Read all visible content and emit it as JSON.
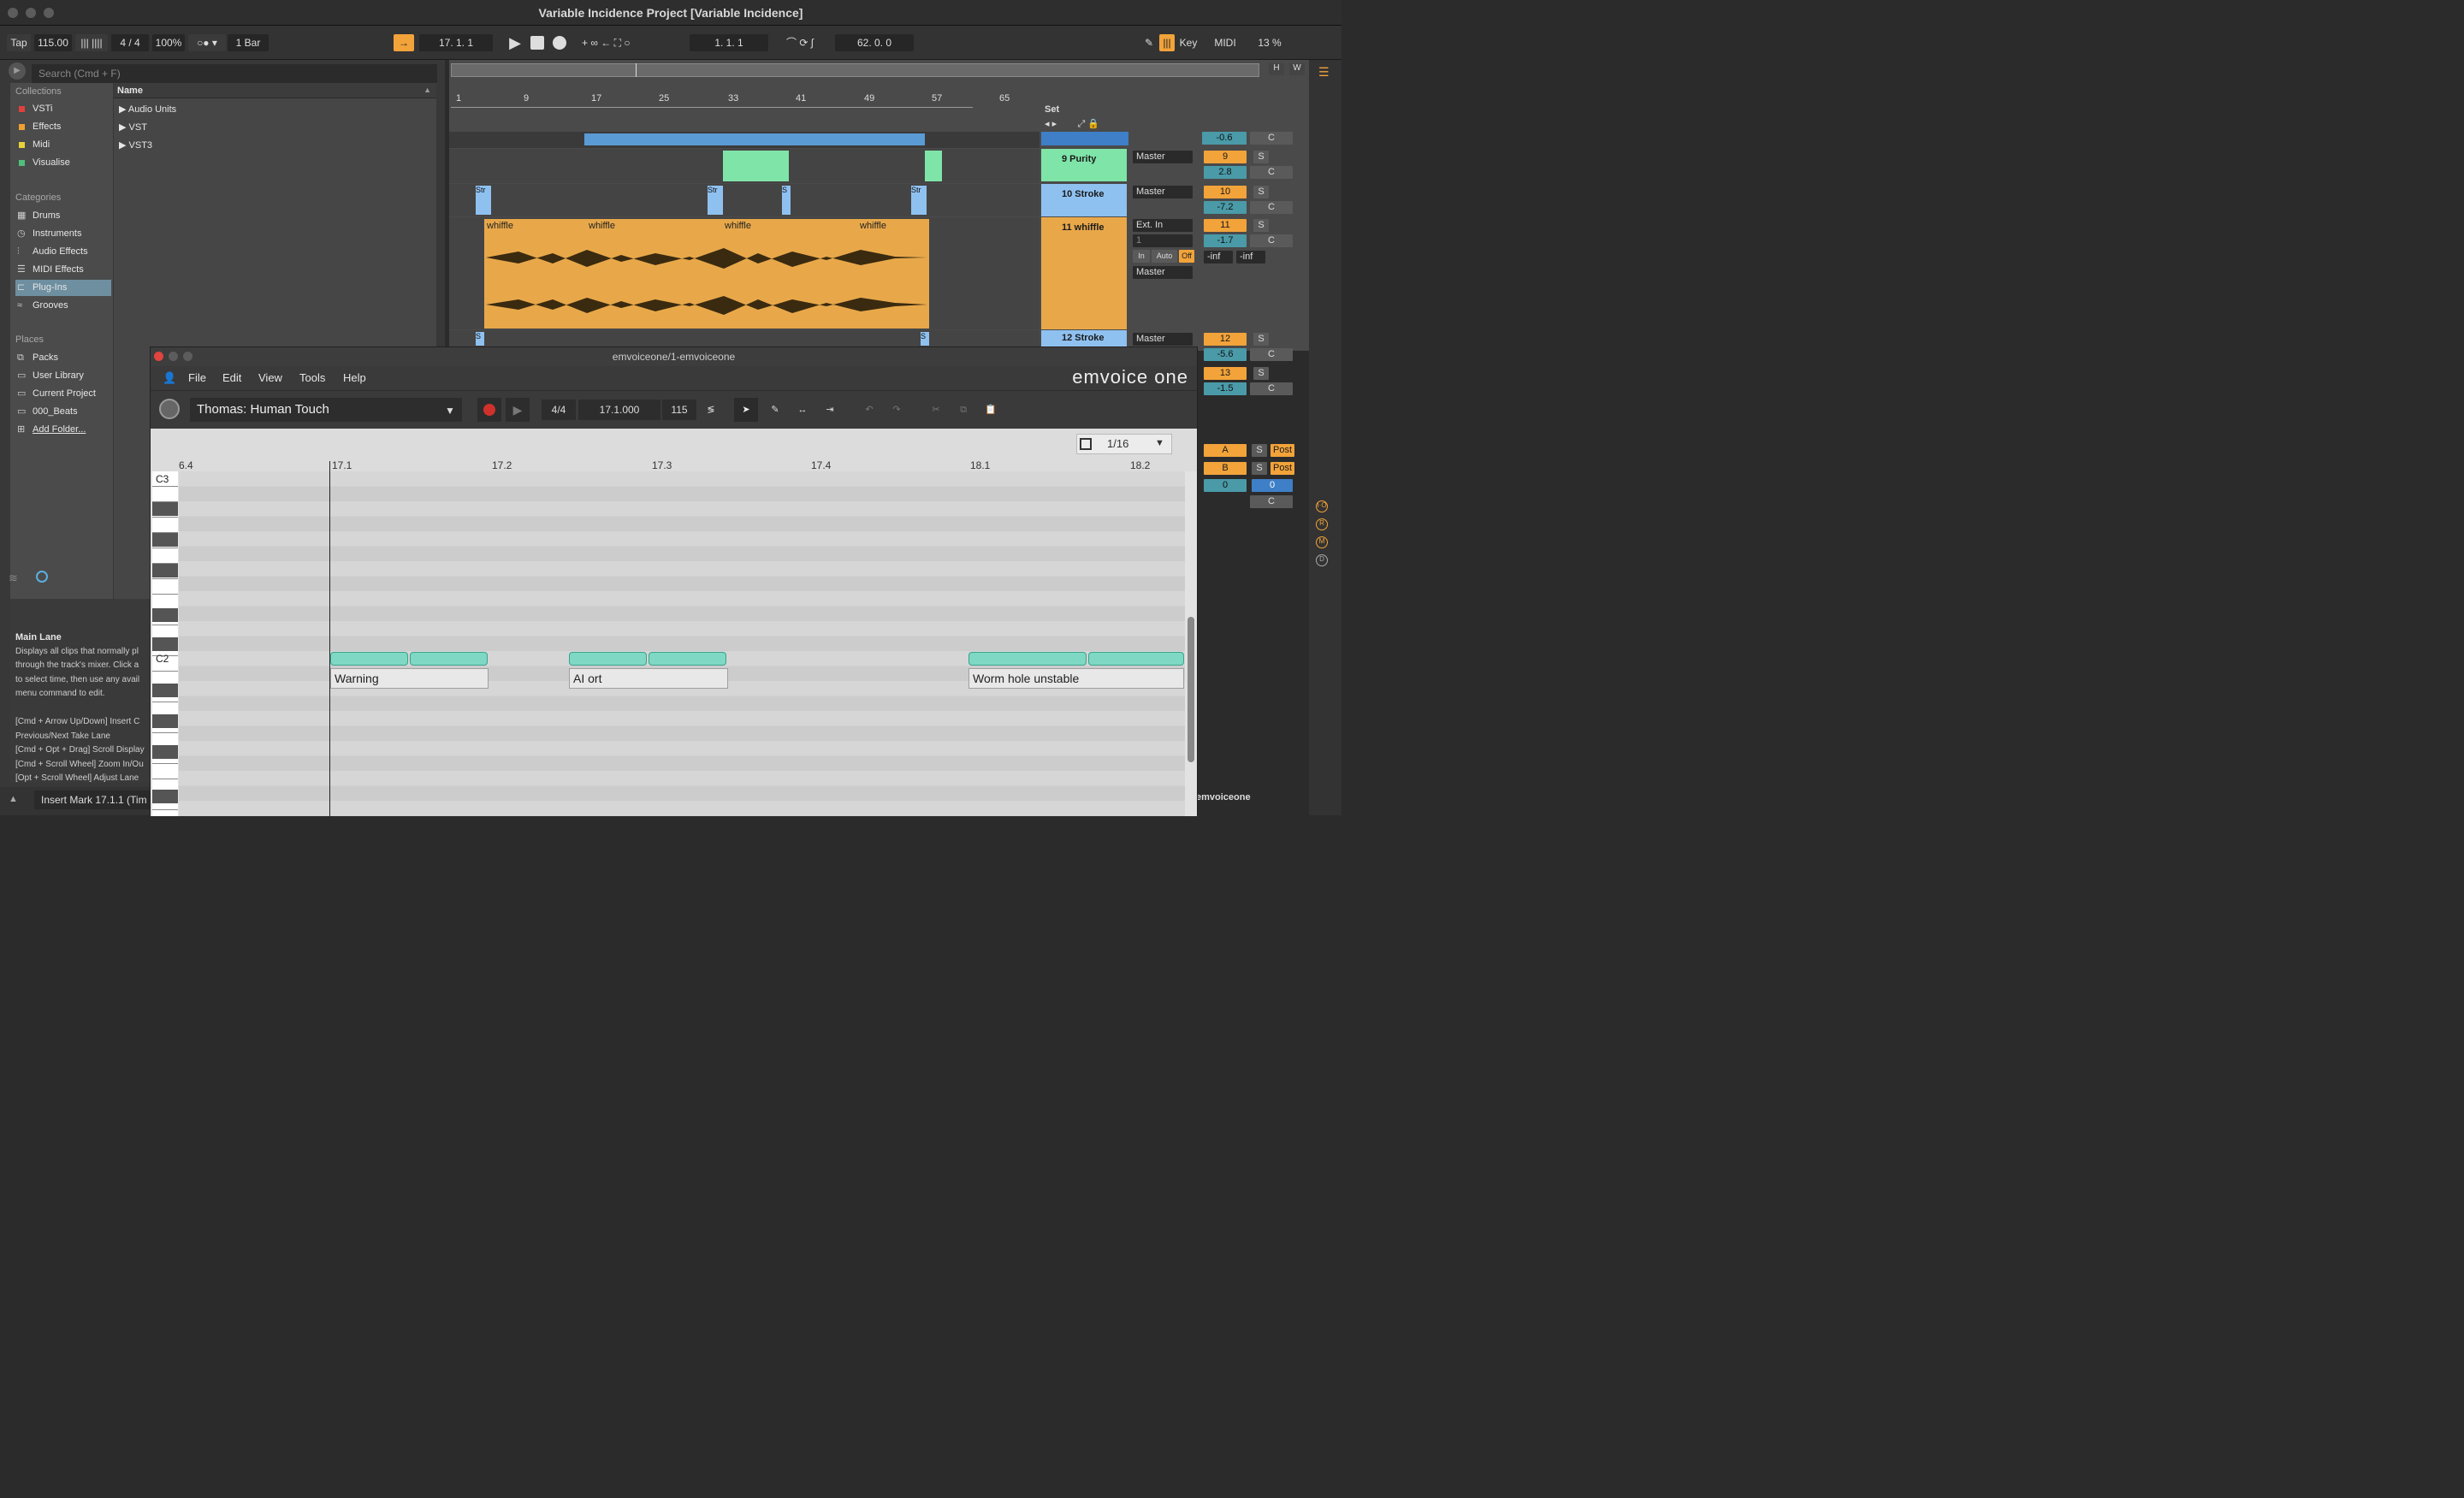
{
  "window": {
    "title": "Variable Incidence Project  [Variable Incidence]"
  },
  "transport": {
    "tap": "Tap",
    "tempo": "115.00",
    "signature": "4 / 4",
    "zoom": "100%",
    "quantize": "1 Bar",
    "position": "17.  1.  1",
    "loop_start": "1.  1.  1",
    "loop_length": "62.  0.  0",
    "key": "Key",
    "midi": "MIDI",
    "cpu": "13 %"
  },
  "browser": {
    "search_placeholder": "Search (Cmd + F)",
    "collections_head": "Collections",
    "collections": [
      {
        "label": "VSTi",
        "color": "#e0413a"
      },
      {
        "label": "Effects",
        "color": "#f0a030"
      },
      {
        "label": "Midi",
        "color": "#e6d23a"
      },
      {
        "label": "Visualise",
        "color": "#4fc07b"
      }
    ],
    "categories_head": "Categories",
    "categories": [
      "Drums",
      "Instruments",
      "Audio Effects",
      "MIDI Effects",
      "Plug-Ins",
      "Grooves"
    ],
    "places_head": "Places",
    "places": [
      "Packs",
      "User Library",
      "Current Project",
      "000_Beats",
      "Add Folder..."
    ],
    "column_name": "Name",
    "tree": [
      "Audio Units",
      "VST",
      "VST3"
    ]
  },
  "info": {
    "title": "Main Lane",
    "text": "Displays all clips that normally pl\nthrough the track's mixer. Click a\nto select time, then use any avail\nmenu command to edit.\n\n[Cmd + Arrow Up/Down] Insert C\nPrevious/Next Take Lane\n[Cmd + Opt + Drag] Scroll Display\n[Cmd + Scroll Wheel] Zoom In/Ou\n[Opt + Scroll Wheel] Adjust Lane"
  },
  "status": {
    "insert_mark": "Insert Mark 17.1.1 (Tim",
    "right_label": "emvoiceone"
  },
  "arrangement": {
    "ruler": [
      "1",
      "9",
      "17",
      "25",
      "33",
      "41",
      "49",
      "57",
      "65"
    ],
    "set": "Set",
    "tracks": [
      {
        "name": "9 Purity",
        "output": "Master",
        "num": "9",
        "vol": "2.8",
        "pan": "C"
      },
      {
        "name": "10 Stroke",
        "output": "Master",
        "num": "10",
        "vol": "-7.2",
        "pan": "C"
      },
      {
        "name": "11 whiffle",
        "input": "Ext. In",
        "ch": "1",
        "output": "Master",
        "num": "11",
        "vol": "-1.7",
        "pan": "C",
        "in": "In",
        "auto": "Auto",
        "off": "Off",
        "peak_l": "-inf",
        "peak_r": "-inf"
      },
      {
        "name": "12 Stroke",
        "output": "Master",
        "num": "12",
        "vol": "-5.6",
        "pan": "C"
      }
    ],
    "top_vol": "-0.6",
    "top_pan": "C",
    "t13_num": "13",
    "t13_vol": "-1.5",
    "t13_pan": "C",
    "clip_stroke": "Str",
    "clip_s": "S",
    "clip_whiffle": "whiffle",
    "returns": [
      {
        "label": "A",
        "post": "Post",
        "s": "S"
      },
      {
        "label": "B",
        "post": "Post",
        "s": "S"
      }
    ],
    "master_a": "0",
    "master_b": "0",
    "master_pan": "C",
    "mute_s": "S",
    "hw": [
      "H",
      "W"
    ]
  },
  "plugin": {
    "title": "emvoiceone/1-emvoiceone",
    "menu": [
      "File",
      "Edit",
      "View",
      "Tools",
      "Help"
    ],
    "brand": "emvoice one",
    "voice": "Thomas: Human Touch",
    "signature": "4/4",
    "position": "17.1.000",
    "tempo": "115",
    "grid": "1/16",
    "ruler": [
      "6.4",
      "17.1",
      "17.2",
      "17.3",
      "17.4",
      "18.1",
      "18.2"
    ],
    "c3": "C3",
    "c2": "C2",
    "lyrics": [
      "Warning",
      "AI ort",
      "Worm hole unstable"
    ]
  }
}
